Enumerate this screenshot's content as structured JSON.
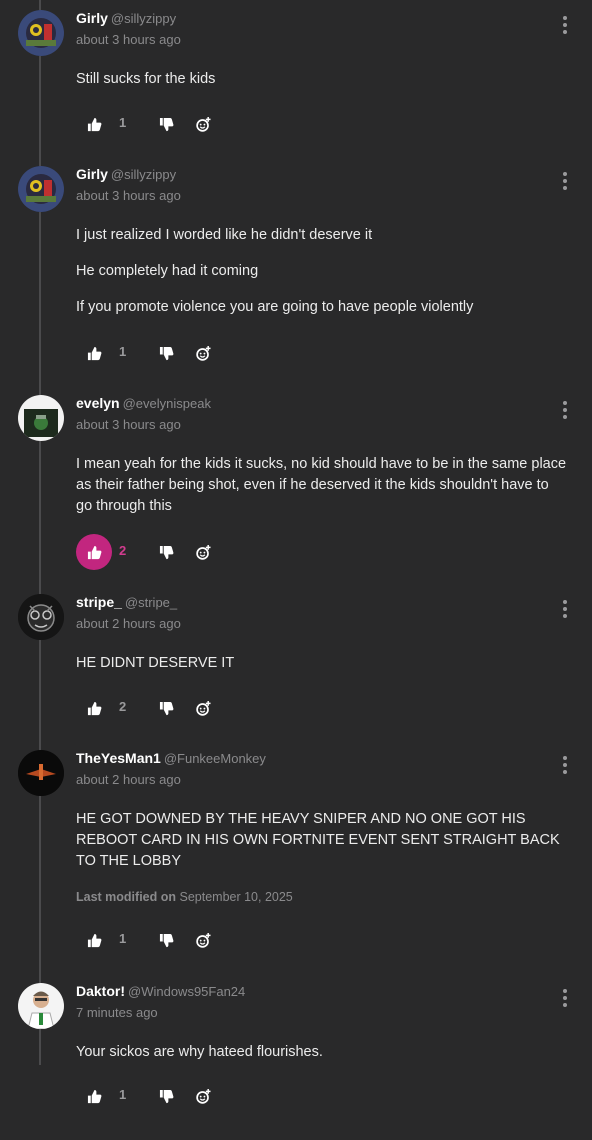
{
  "comments": [
    {
      "name": "Girly",
      "handle": "@sillyzippy",
      "time": "about 3 hours ago",
      "paragraphs": [
        "Still sucks for the kids"
      ],
      "likes": "1",
      "liked": false,
      "avatar": "girly-avatar"
    },
    {
      "name": "Girly",
      "handle": "@sillyzippy",
      "time": "about 3 hours ago",
      "paragraphs": [
        "I just realized I worded like he didn't deserve it",
        "He completely had it coming",
        "If you promote violence you are going to have people violently"
      ],
      "likes": "1",
      "liked": false,
      "avatar": "girly-avatar"
    },
    {
      "name": "evelyn",
      "handle": "@evelynispeak",
      "time": "about 3 hours ago",
      "paragraphs": [
        "I mean yeah for the kids it sucks, no kid should have to be in the same place as their father being shot, even if he deserved it the kids shouldn't have to go through this"
      ],
      "likes": "2",
      "liked": true,
      "avatar": "evelyn-avatar"
    },
    {
      "name": "stripe_",
      "handle": "@stripe_",
      "time": "about 2 hours ago",
      "paragraphs": [
        "HE DIDNT DESERVE IT"
      ],
      "likes": "2",
      "liked": false,
      "avatar": "stripe-avatar"
    },
    {
      "name": "TheYesMan1",
      "handle": "@FunkeeMonkey",
      "time": "about 2 hours ago",
      "paragraphs": [
        "HE GOT DOWNED BY THE HEAVY SNIPER AND NO ONE GOT HIS REBOOT CARD IN HIS OWN FORTNITE EVENT SENT STRAIGHT BACK TO THE LOBBY"
      ],
      "modified_label": "Last modified on",
      "modified_date": "September 10, 2025",
      "likes": "1",
      "liked": false,
      "avatar": "yesman-avatar"
    },
    {
      "name": "Daktor!",
      "handle": "@Windows95Fan24",
      "time": "7 minutes ago",
      "paragraphs": [
        "Your sickos are why hateed flourishes."
      ],
      "likes": "1",
      "liked": false,
      "avatar": "daktor-avatar"
    }
  ],
  "colors": {
    "background": "#29292a",
    "liked_accent": "#c2267f",
    "muted": "#8a8a8c"
  }
}
